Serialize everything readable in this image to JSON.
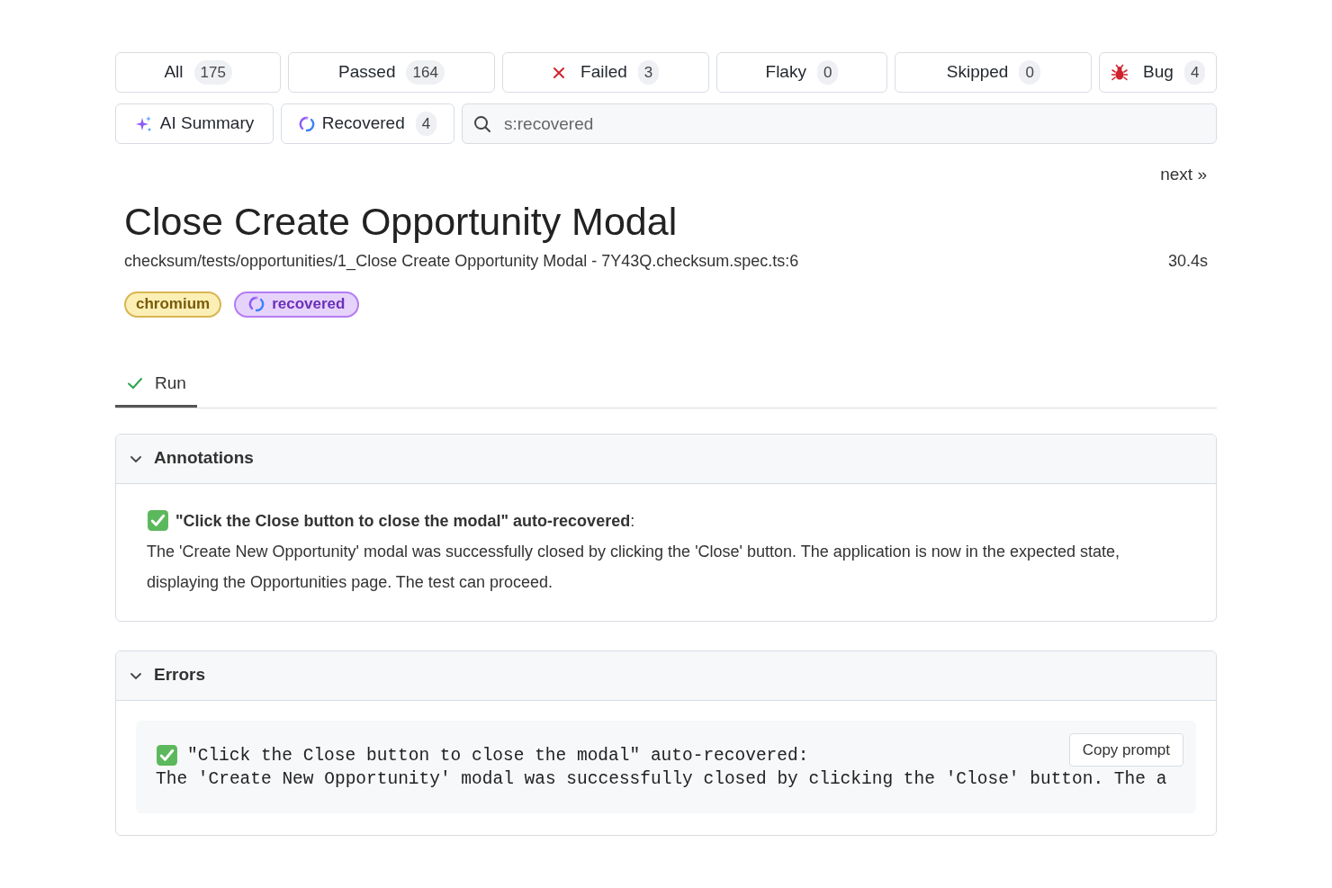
{
  "filters": [
    {
      "label": "All",
      "count": "175",
      "kind": "plain",
      "selected": false
    },
    {
      "label": "Passed",
      "count": "164",
      "kind": "plain",
      "selected": false
    },
    {
      "label": "Failed",
      "count": "3",
      "kind": "failed",
      "selected": false
    },
    {
      "label": "Flaky",
      "count": "0",
      "kind": "plain",
      "selected": false
    },
    {
      "label": "Skipped",
      "count": "0",
      "kind": "plain",
      "selected": false
    },
    {
      "label": "Bug",
      "count": "4",
      "kind": "bug",
      "selected": false
    }
  ],
  "toolbar": [
    {
      "label": "AI Summary",
      "kind": "summary"
    },
    {
      "label": "Recovered",
      "count": "4",
      "kind": "recovered"
    }
  ],
  "search": {
    "value": "s:recovered"
  },
  "next_link": "next »",
  "test": {
    "title": "Close Create Opportunity Modal",
    "path": "checksum/tests/opportunities/1_Close Create Opportunity Modal - 7Y43Q.checksum.spec.ts:6",
    "duration": "30.4s",
    "tags": [
      {
        "label": "chromium",
        "kind": "plain"
      },
      {
        "label": "recovered",
        "kind": "recovered"
      }
    ]
  },
  "tabs": [
    {
      "label": "Run",
      "selected": true
    }
  ],
  "sections": [
    {
      "title": "Annotations",
      "expanded": true,
      "kind": "annotation",
      "heading": "**\"Click the Close button to close the modal\" auto-recovered**:",
      "body": "The 'Create New Opportunity' modal was successfully closed by clicking the 'Close' button. The application is now in the expected state, displaying the Opportunities page. The test can proceed."
    },
    {
      "title": "Errors",
      "expanded": true,
      "kind": "error",
      "lines": [
        "\"Click the Close button to close the modal\" auto-recovered:",
        "The 'Create New Opportunity' modal was successfully closed by clicking the 'Close' button. The a"
      ],
      "button": "Copy prompt"
    }
  ]
}
